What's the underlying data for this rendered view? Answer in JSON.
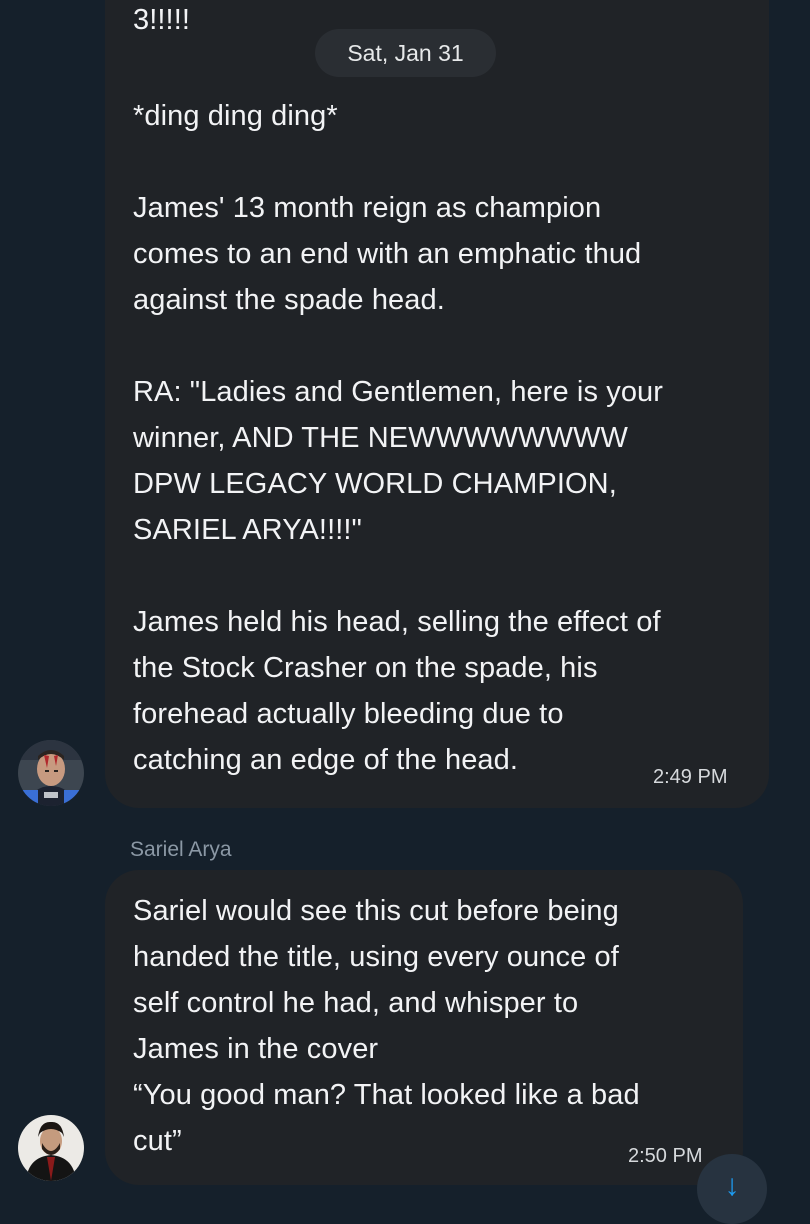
{
  "thread": {
    "date_separator": "Sat, Jan 31"
  },
  "messages": [
    {
      "head_text": "3!!!!!",
      "body_text": "*ding ding ding*\n\nJames' 13 month reign as champion\ncomes to an end with an emphatic thud\nagainst the spade head.\n\nRA: \"Ladies and Gentlemen, here is your\nwinner, AND THE NEWWWWWWWW\nDPW LEGACY WORLD CHAMPION,\nSARIEL ARYA!!!!\"\n\nJames held his head, selling the effect of\nthe Stock Crasher on the spade, his\nforehead actually bleeding due to\ncatching an edge of the head.",
      "time": "2:49 PM",
      "avatar_icon": "wrestler-avatar-bloodied"
    },
    {
      "sender": "Sariel Arya",
      "body_text": "Sariel would see this cut before being\nhanded the title, using every ounce of\nself control he had, and whisper to\nJames in the cover\n“You good man? That looked like a bad\ncut”",
      "time": "2:50 PM",
      "avatar_icon": "wrestler-avatar-bearded"
    }
  ],
  "controls": {
    "scroll_down_icon": "arrow-down-icon"
  },
  "colors": {
    "background": "#15202b",
    "bubble": "#202327",
    "accent": "#1d9bf0",
    "muted_text": "#8b98a5"
  }
}
